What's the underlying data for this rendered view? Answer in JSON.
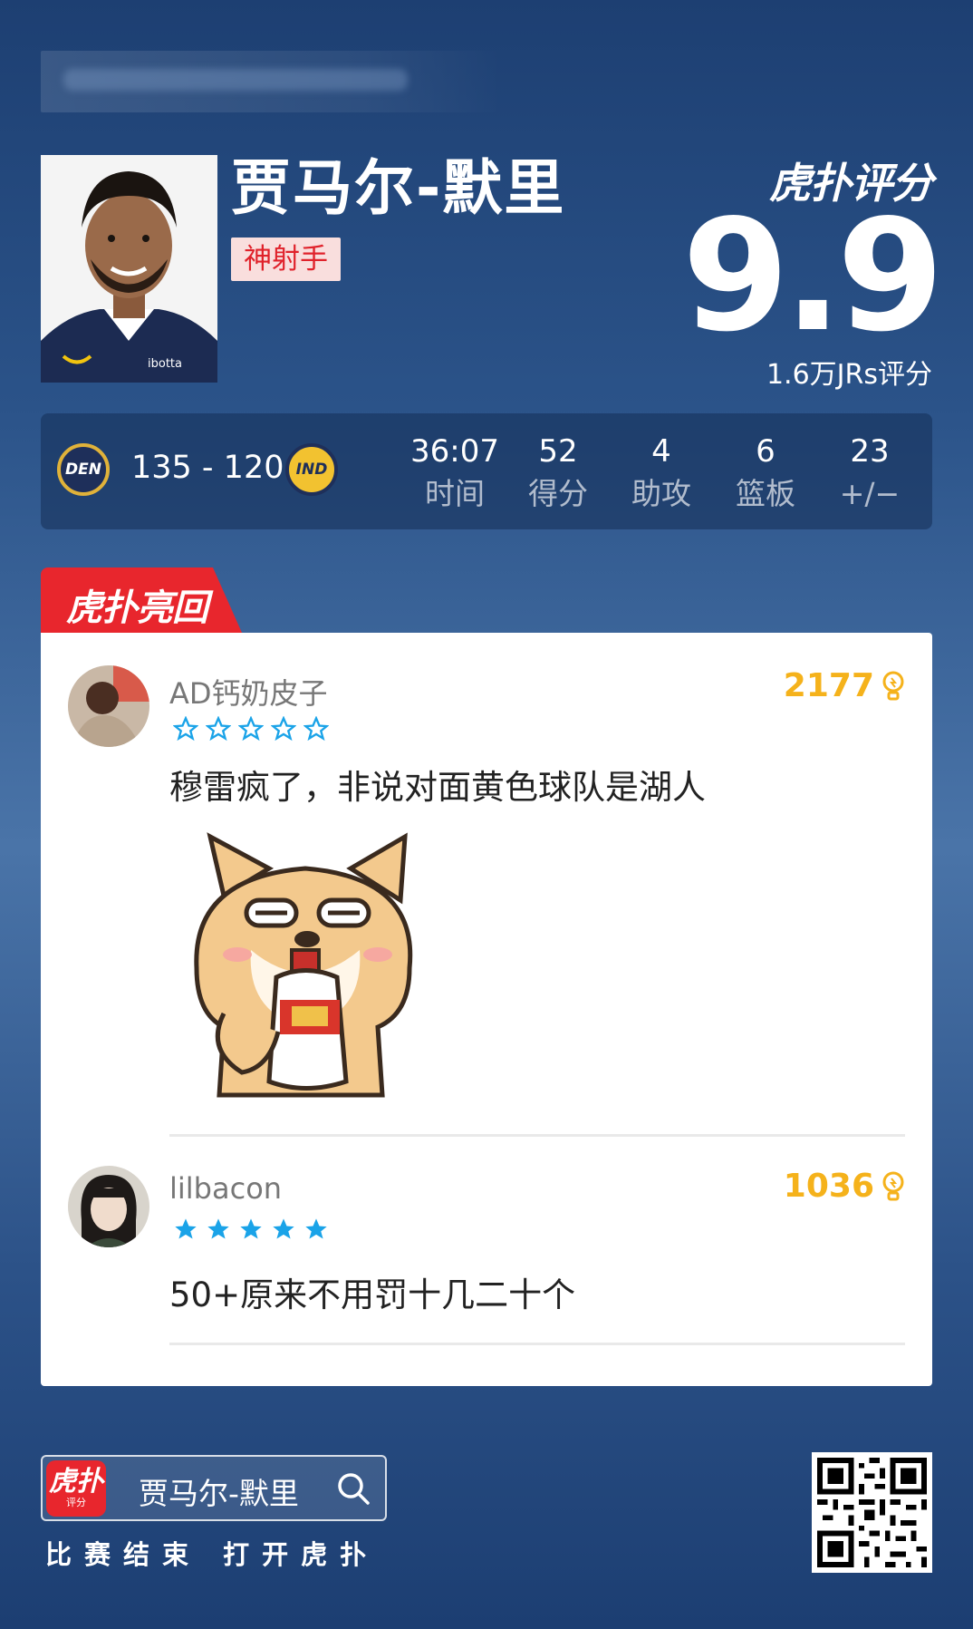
{
  "player": {
    "name": "贾马尔-默里",
    "tag": "神射手"
  },
  "rating": {
    "logo": "虎扑评分",
    "value": "9.9",
    "count_text": "1.6万JRs评分"
  },
  "game": {
    "home_team": "DEN",
    "away_team": "IND",
    "score": "135 - 120",
    "stats": [
      {
        "value": "36:07",
        "label": "时间"
      },
      {
        "value": "52",
        "label": "得分"
      },
      {
        "value": "4",
        "label": "助攻"
      },
      {
        "value": "6",
        "label": "篮板"
      },
      {
        "value": "23",
        "label": "+/−"
      }
    ]
  },
  "comments_section": {
    "tab_label": "虎扑亮回复",
    "comments": [
      {
        "user": "AD钙奶皮子",
        "likes": "2177",
        "stars": 0,
        "text": "穆雷疯了，非说对面黄色球队是湖人",
        "has_sticker": true
      },
      {
        "user": "lilbacon",
        "likes": "1036",
        "stars": 5,
        "text": "50+原来不用罚十几二十个",
        "has_sticker": false
      }
    ]
  },
  "footer": {
    "app_icon_main": "虎扑",
    "app_icon_sub": "评分",
    "search_text": "贾马尔-默里",
    "cta": "比赛结束 打开虎扑"
  },
  "colors": {
    "accent_red": "#e8262d",
    "likes_gold": "#f5b21b",
    "star_blue": "#1aa3e8",
    "background_blue": "#2b5389"
  },
  "icons": [
    "search-icon",
    "bulb-icon",
    "star-icon",
    "qr-code"
  ]
}
